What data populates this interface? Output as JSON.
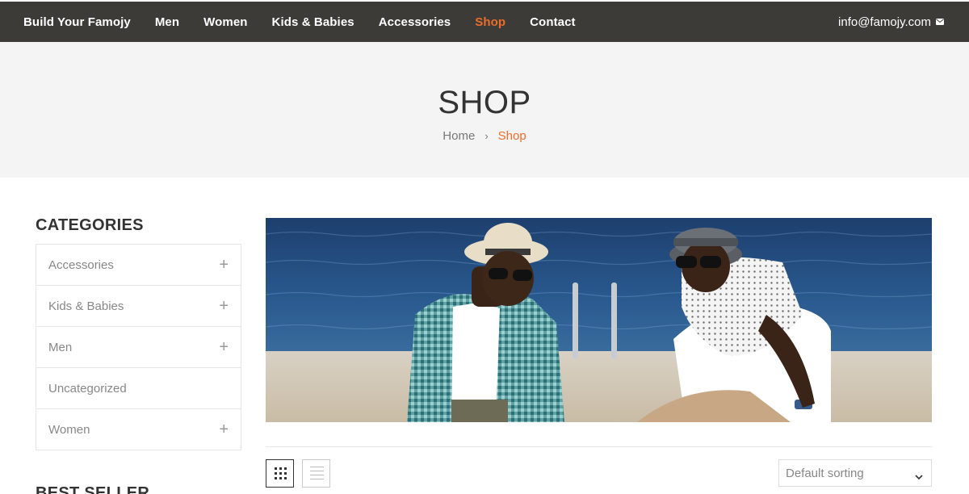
{
  "nav": {
    "items": [
      {
        "label": "Build Your Famojy",
        "active": false
      },
      {
        "label": "Men",
        "active": false
      },
      {
        "label": "Women",
        "active": false
      },
      {
        "label": "Kids & Babies",
        "active": false
      },
      {
        "label": "Accessories",
        "active": false
      },
      {
        "label": "Shop",
        "active": true
      },
      {
        "label": "Contact",
        "active": false
      }
    ],
    "email": "info@famojy.com",
    "email_icon": "envelope-icon"
  },
  "header": {
    "title": "SHOP",
    "breadcrumb": {
      "home": "Home",
      "separator": "›",
      "current": "Shop"
    }
  },
  "sidebar": {
    "categories_title": "CATEGORIES",
    "categories": [
      {
        "label": "Accessories",
        "expandable": true
      },
      {
        "label": "Kids & Babies",
        "expandable": true
      },
      {
        "label": "Men",
        "expandable": true
      },
      {
        "label": "Uncategorized",
        "expandable": false
      },
      {
        "label": "Women",
        "expandable": true
      }
    ],
    "bestseller_title": "BEST SELLER"
  },
  "banner": {
    "image": "two-men-sunglasses-hats-by-water"
  },
  "toolbar": {
    "grid_view_icon": "grid-icon",
    "list_view_icon": "list-icon",
    "sort_value": "Default sorting"
  },
  "colors": {
    "nav_bg": "#3d3b38",
    "accent": "#ea6d2c",
    "header_bg": "#f4f4f4"
  }
}
